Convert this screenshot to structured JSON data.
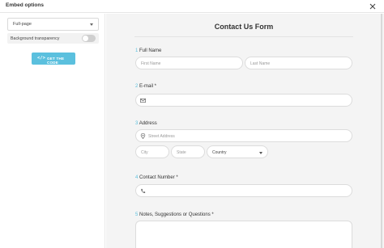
{
  "header": {
    "title": "Embed options"
  },
  "sidebar": {
    "mode_select": {
      "value": "Full-page"
    },
    "background_transparency": {
      "label": "Background transparency"
    },
    "get_code_button": {
      "icon": "</>",
      "label": "GET THE CODE"
    }
  },
  "form": {
    "title": "Contact Us Form",
    "questions": [
      {
        "number": "1",
        "label": "Full Name",
        "fields": [
          {
            "placeholder": "First Name"
          },
          {
            "placeholder": "Last Name"
          }
        ]
      },
      {
        "number": "2",
        "label": "E-mail *",
        "fields": [
          {
            "placeholder": "",
            "icon": "envelope-icon"
          }
        ]
      },
      {
        "number": "3",
        "label": "Address",
        "fields": [
          {
            "placeholder": "Street Address",
            "icon": "map-pin-icon"
          },
          {
            "placeholder": "City"
          },
          {
            "placeholder": "State"
          },
          {
            "placeholder": "Country"
          }
        ]
      },
      {
        "number": "4",
        "label": "Contact Number *",
        "fields": [
          {
            "placeholder": "",
            "icon": "phone-icon"
          }
        ]
      },
      {
        "number": "5",
        "label": "Notes, Suggestions or Questions *",
        "fields": [
          {
            "placeholder": ""
          }
        ]
      }
    ]
  },
  "colors": {
    "accent": "#5bc0de",
    "form_bg": "#f4f4f4"
  }
}
